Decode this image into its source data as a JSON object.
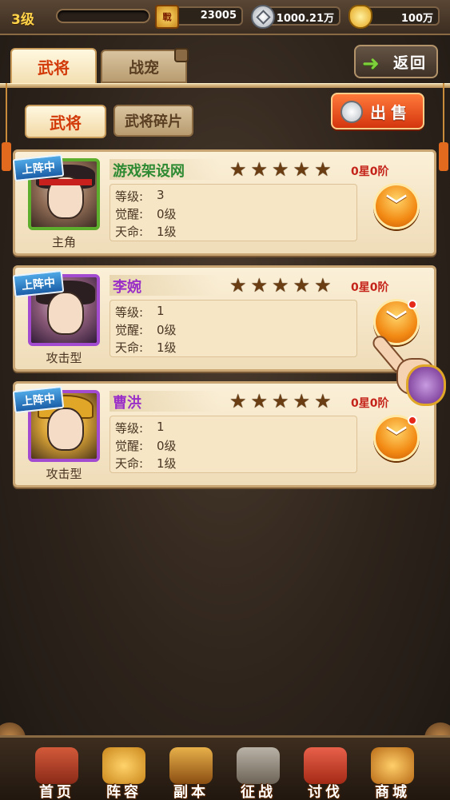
{
  "header": {
    "level": "3级",
    "power": "23005",
    "silver": "1000.21万",
    "gold": "100万",
    "power_icon_text": "戰"
  },
  "tabs": {
    "main": [
      {
        "label": "武将",
        "active": true
      },
      {
        "label": "战宠",
        "active": false,
        "locked": true
      }
    ],
    "sub": [
      {
        "label": "武将",
        "active": true
      },
      {
        "label": "武将碎片",
        "active": false
      }
    ],
    "return_label": "返回",
    "sell_label": "出售"
  },
  "labels": {
    "level": "等级:",
    "awaken": "觉醒:",
    "destiny": "天命:",
    "deployed": "上阵中"
  },
  "heroes": [
    {
      "name": "游戏架设网",
      "role": "主角",
      "stars": 5,
      "rank": "0星0阶",
      "level": "3",
      "awaken": "0级",
      "destiny": "1级",
      "quality": "green",
      "notify": false
    },
    {
      "name": "李婉",
      "role": "攻击型",
      "stars": 5,
      "rank": "0星0阶",
      "level": "1",
      "awaken": "0级",
      "destiny": "1级",
      "quality": "purple",
      "notify": true
    },
    {
      "name": "曹洪",
      "role": "攻击型",
      "stars": 5,
      "rank": "0星0阶",
      "level": "1",
      "awaken": "0级",
      "destiny": "1级",
      "quality": "purple",
      "notify": true
    }
  ],
  "nav": [
    {
      "label": "首页",
      "icon": "home-icon"
    },
    {
      "label": "阵容",
      "icon": "team-icon"
    },
    {
      "label": "副本",
      "icon": "dungeon-icon"
    },
    {
      "label": "征战",
      "icon": "expedition-icon"
    },
    {
      "label": "讨伐",
      "icon": "crusade-icon"
    },
    {
      "label": "商城",
      "icon": "shop-icon"
    }
  ],
  "colors": {
    "accent_red": "#d23a0a",
    "name_green": "#2e8a32",
    "name_purple": "#9a2fc8",
    "badge_blue": "#1b5fa8"
  }
}
